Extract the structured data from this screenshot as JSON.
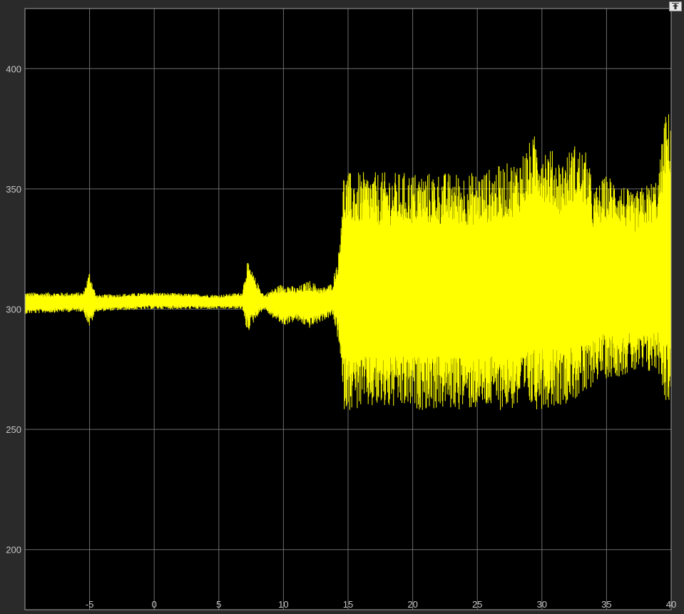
{
  "chart_data": {
    "type": "line",
    "title": "",
    "xlabel": "",
    "ylabel": "",
    "xlim": [
      -10,
      40
    ],
    "ylim": [
      175,
      425
    ],
    "grid": true,
    "x_ticks": [
      -5,
      0,
      5,
      10,
      15,
      20,
      25,
      30,
      35,
      40
    ],
    "y_ticks": [
      200,
      250,
      300,
      350,
      400
    ],
    "colors": {
      "background": "#000000",
      "line": "#ffff00",
      "grid": "#6e6e6e",
      "axes": "#a0a0a0",
      "figure": "#2a2a2a"
    },
    "series": [
      {
        "color": "#ffff00",
        "envelope_times": [
          -10,
          -5.5,
          -5,
          -4.5,
          0,
          5,
          6.8,
          7.2,
          8,
          8.5,
          9,
          10,
          11,
          12,
          13,
          13.8,
          14.3,
          14.6,
          15,
          20,
          25,
          28,
          29.5,
          30.5,
          31.5,
          32.5,
          33.5,
          34,
          35,
          36,
          37,
          38,
          39,
          39.5,
          40
        ],
        "upper": [
          307,
          307,
          316,
          306,
          307,
          306,
          307,
          320,
          311,
          306,
          308,
          311,
          309,
          312,
          309,
          311,
          325,
          357,
          357,
          357,
          357,
          362,
          373,
          368,
          362,
          369,
          365,
          350,
          356,
          354,
          348,
          352,
          355,
          381,
          383
        ],
        "lower": [
          298,
          299,
          292,
          299,
          300,
          300,
          300,
          290,
          297,
          300,
          297,
          293,
          295,
          292,
          295,
          297,
          285,
          258,
          258,
          258,
          258,
          258,
          258,
          259,
          260,
          262,
          262,
          270,
          271,
          272,
          273,
          272,
          274,
          262,
          259
        ]
      }
    ]
  },
  "toolbar": {
    "restore_icon": "restore-axes-icon"
  }
}
